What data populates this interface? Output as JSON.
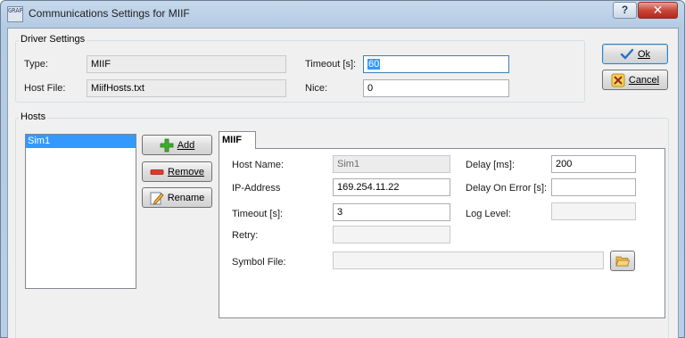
{
  "window": {
    "title": "Communications Settings for MIIF",
    "icon_text": "GRAPH",
    "help_glyph": "?",
    "close_glyph": "✕"
  },
  "driver_settings": {
    "legend": "Driver Settings",
    "type_label": "Type:",
    "type_value": "MIIF",
    "host_file_label": "Host File:",
    "host_file_value": "MiifHosts.txt",
    "timeout_label": "Timeout [s]:",
    "timeout_value": "60",
    "nice_label": "Nice:",
    "nice_value": "0"
  },
  "dialog_buttons": {
    "ok_label": "Ok",
    "cancel_label": "Cancel"
  },
  "hosts": {
    "legend": "Hosts",
    "items": [
      "Sim1"
    ],
    "selected_index": 0,
    "add_label": "Add",
    "remove_label": "Remove",
    "rename_label": "Rename"
  },
  "host_tab": {
    "tab_label": "MIIF",
    "host_name_label": "Host Name:",
    "host_name_value": "Sim1",
    "ip_label": "IP-Address",
    "ip_value": "169.254.11.22",
    "timeout_label": "Timeout [s]:",
    "timeout_value": "3",
    "retry_label": "Retry:",
    "retry_value": "",
    "symbol_file_label": "Symbol File:",
    "symbol_file_value": "",
    "delay_label": "Delay [ms]:",
    "delay_value": "200",
    "delay_on_error_label": "Delay On Error [s]:",
    "delay_on_error_value": "",
    "log_level_label": "Log Level:",
    "log_level_value": ""
  },
  "icons": {
    "ok": "checkmark-icon",
    "cancel": "x-cancel-icon",
    "add": "green-plus-icon",
    "remove": "red-minus-icon",
    "rename": "rename-pencil-icon",
    "browse": "folder-open-icon"
  },
  "colors": {
    "selection": "#3399ff",
    "close_button": "#c8483a",
    "title_bar": "#b9cee6"
  }
}
